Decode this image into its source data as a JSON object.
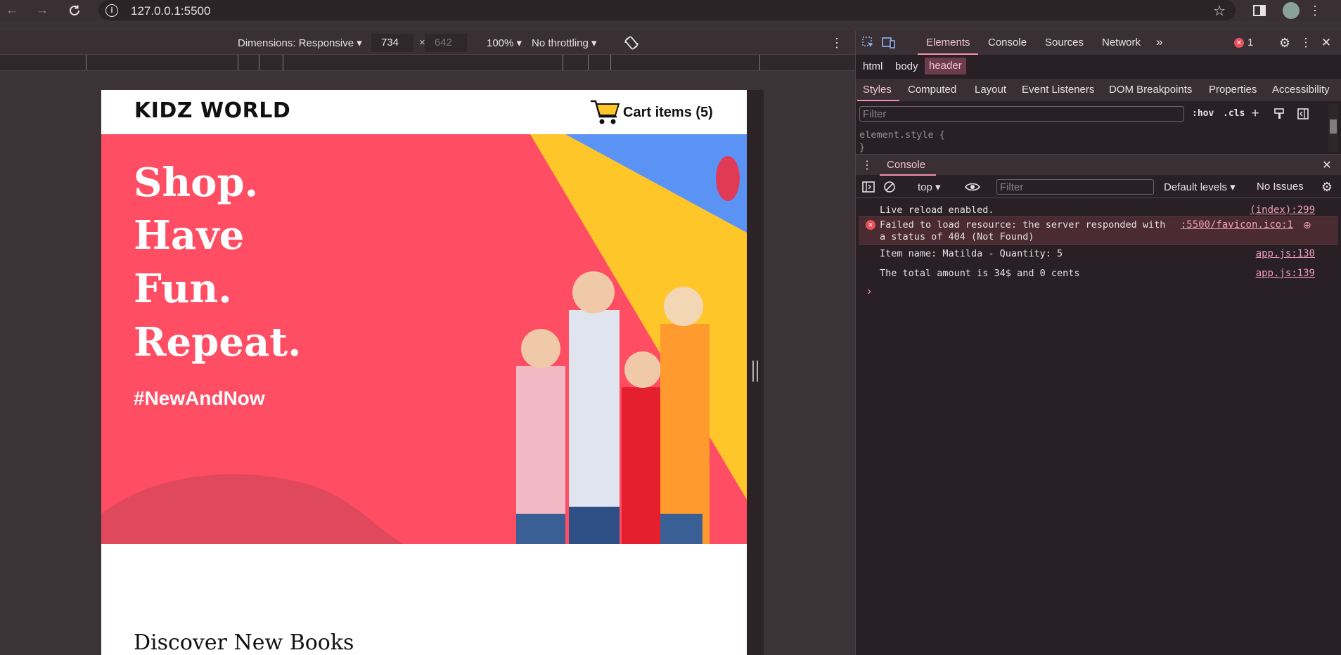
{
  "browser": {
    "url": "127.0.0.1:5500"
  },
  "device_toolbar": {
    "dimensions": "Dimensions: Responsive",
    "width": "734",
    "times": "×",
    "height": "642",
    "zoom": "100%",
    "throttling": "No throttling"
  },
  "page": {
    "logo": "KIDZ WORLD",
    "cart_label": "Cart items (5)",
    "hero_lines": [
      "Shop.",
      "Have",
      "Fun.",
      "Repeat."
    ],
    "hashtag": "#NewAndNow",
    "section_title": "Discover New Books"
  },
  "devtools": {
    "tabs": [
      "Elements",
      "Console",
      "Sources",
      "Network"
    ],
    "more_tabs": "»",
    "error_count": "1",
    "breadcrumb": [
      "html",
      "body",
      "header"
    ],
    "style_tabs": [
      "Styles",
      "Computed",
      "Layout",
      "Event Listeners",
      "DOM Breakpoints",
      "Properties",
      "Accessibility"
    ],
    "filter_placeholder": "Filter",
    "hov": ":hov",
    "cls": ".cls",
    "element_style": "element.style {",
    "brace": "}",
    "drawer_title": "Console",
    "context": "top",
    "console_filter_placeholder": "Filter",
    "levels": "Default levels",
    "issues": "No Issues",
    "messages": [
      {
        "text": "Live reload enabled.",
        "source": "(index):299"
      },
      {
        "text": "Failed to load resource: the server responded with",
        "text2": "a status of 404 (Not Found)",
        "source": ":5500/favicon.ico:1",
        "level": "error"
      },
      {
        "text": "Item name: Matilda - Quantity: 5",
        "source": "app.js:130"
      },
      {
        "text": "The total amount is 34$ and 0 cents",
        "source": "app.js:139"
      }
    ],
    "prompt": "›"
  },
  "colors": {
    "hero_bg": "#ff4d63",
    "accent": "#f28fb0",
    "yellow": "#ffc629",
    "blue": "#5b93f5"
  }
}
